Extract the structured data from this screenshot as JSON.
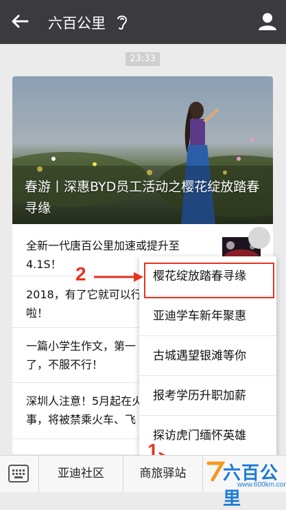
{
  "header": {
    "title": "六百公里"
  },
  "message": {
    "time": "23:33"
  },
  "article": {
    "hero_title": "春游丨深惠BYD员工活动之樱花绽放踏春寻缘",
    "items": [
      {
        "line1": "全新一代唐百公里加速或提升至",
        "line2": "4.1S！"
      },
      {
        "line1": "2018，有了它就可以行",
        "line2": "啦！"
      },
      {
        "line1": "一篇小学生作文，第一",
        "line2": "了，不服不行！"
      },
      {
        "line1": "深圳人注意！5月起在火",
        "line2": "事，将被禁乘火车、飞"
      }
    ]
  },
  "menu": {
    "items": [
      "樱花绽放踏春寻缘",
      "亚迪学车新年聚惠",
      "古城遇望银滩等你",
      "报考学历升职加薪",
      "探访虎门缅怀英雄"
    ]
  },
  "annotations": {
    "label_1": "1",
    "label_2": "2"
  },
  "bottom_bar": {
    "tabs": [
      "亚迪社区",
      "商旅驿站"
    ]
  },
  "watermark": {
    "text": "六百公里",
    "url": "www.600km.com"
  },
  "colors": {
    "topbar": "#3a3a3f",
    "highlight_red": "#e8321f",
    "logo_blue": "#1a7ad8"
  }
}
